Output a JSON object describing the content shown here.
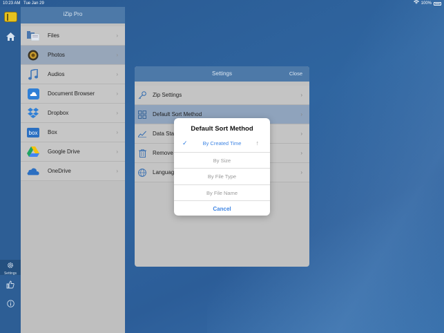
{
  "status_bar": {
    "time": "10:23 AM",
    "date": "Tue Jan 29",
    "battery": "100%"
  },
  "app": {
    "title": "iZip Pro"
  },
  "rail": {
    "settings_label": "Settings"
  },
  "sources": [
    {
      "label": "Files",
      "icon": "folder-icon"
    },
    {
      "label": "Photos",
      "icon": "photos-icon",
      "selected": true
    },
    {
      "label": "Audios",
      "icon": "music-note-icon"
    },
    {
      "label": "Document Browser",
      "icon": "cloud-icon"
    },
    {
      "label": "Dropbox",
      "icon": "dropbox-icon"
    },
    {
      "label": "Box",
      "icon": "box-icon"
    },
    {
      "label": "Google Drive",
      "icon": "google-drive-icon"
    },
    {
      "label": "OneDrive",
      "icon": "onedrive-icon"
    }
  ],
  "settings": {
    "title": "Settings",
    "close_label": "Close",
    "rows": [
      {
        "label": "Zip Settings",
        "icon": "key-icon"
      },
      {
        "label": "Default Sort Method",
        "icon": "grid-icon",
        "selected": true
      },
      {
        "label": "Data Statis",
        "icon": "chart-icon"
      },
      {
        "label": "Remove A",
        "icon": "trash-icon"
      },
      {
        "label": "Language",
        "icon": "globe-icon"
      }
    ]
  },
  "sort_sheet": {
    "title": "Default Sort Method",
    "options": [
      "By Created Time",
      "By Size",
      "By File Type",
      "By File Name"
    ],
    "selected_index": 0,
    "cancel_label": "Cancel"
  },
  "colors": {
    "accent": "#3e85e4",
    "header": "#4d79a8",
    "background": "#2d5f97"
  }
}
